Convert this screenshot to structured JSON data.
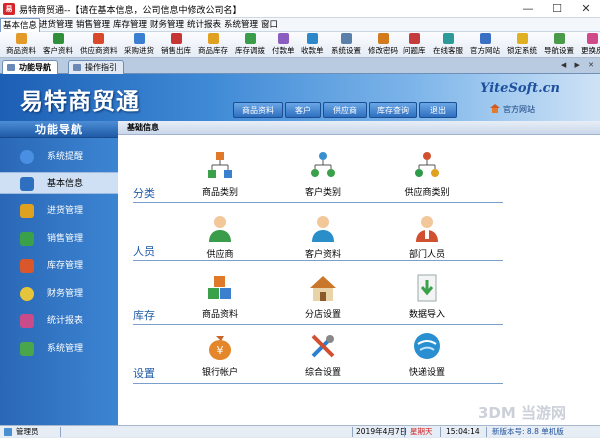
{
  "window": {
    "title": "易特商贸通--【请在基本信息，公司信息中修改公司名】",
    "minimize": "—",
    "maximize": "☐",
    "close": "✕"
  },
  "menu": [
    "基本信息",
    "进货管理",
    "销售管理",
    "库存管理",
    "财务管理",
    "统计报表",
    "系统管理",
    "窗口"
  ],
  "toolbar": [
    {
      "label": "商品资料",
      "icon": "box-icon",
      "color": "#e39a2a"
    },
    {
      "label": "客户资料",
      "icon": "customer-icon",
      "color": "#2f8f3a"
    },
    {
      "label": "供应商资料",
      "icon": "supplier-icon",
      "color": "#d9482b"
    },
    {
      "label": "采购进货",
      "icon": "purchase-icon",
      "color": "#3a7fd0"
    },
    {
      "label": "销售出库",
      "icon": "sales-icon",
      "color": "#c73434"
    },
    {
      "label": "商品库存",
      "icon": "inventory-icon",
      "color": "#e0a020"
    },
    {
      "label": "库存调拨",
      "icon": "transfer-icon",
      "color": "#3a9d4a"
    },
    {
      "label": "付款单",
      "icon": "payment-icon",
      "color": "#8b5dc0"
    },
    {
      "label": "收款单",
      "icon": "receipt-icon",
      "color": "#2c88c9"
    },
    {
      "label": "系统设置",
      "icon": "settings-icon",
      "color": "#5a7fa8"
    },
    {
      "label": "修改密码",
      "icon": "password-icon",
      "color": "#d27a1c"
    },
    {
      "label": "问题库",
      "icon": "question-icon",
      "color": "#c63b3b"
    },
    {
      "label": "在线客服",
      "icon": "chat-icon",
      "color": "#2c9a9a"
    },
    {
      "label": "官方网站",
      "icon": "globe-icon",
      "color": "#3a6fc4"
    },
    {
      "label": "锁定系统",
      "icon": "lock-icon",
      "color": "#e0b020"
    },
    {
      "label": "导航设置",
      "icon": "nav-icon",
      "color": "#4a9a4a"
    },
    {
      "label": "更换皮",
      "icon": "skin-icon",
      "color": "#d04a8a"
    }
  ],
  "tabs": [
    {
      "label": "功能导航",
      "active": true
    },
    {
      "label": "操作指引",
      "active": false
    }
  ],
  "tab_controls": "◀ ▶ ✕",
  "header": {
    "logo": "易特商贸通",
    "site": "YiteSoft.cn",
    "buttons": [
      "商品资料",
      "客户",
      "供应商",
      "库存查询",
      "退出"
    ],
    "official": "官方网站"
  },
  "sidebar": {
    "title": "功能导航",
    "items": [
      {
        "label": "系统提醒",
        "icon": "alarm-icon",
        "color": "#4a90e2",
        "active": false
      },
      {
        "label": "基本信息",
        "icon": "basic-info-icon",
        "color": "#2f6fbf",
        "active": true
      },
      {
        "label": "进货管理",
        "icon": "purchase-mgmt-icon",
        "color": "#e0a020",
        "active": false
      },
      {
        "label": "销售管理",
        "icon": "sales-mgmt-icon",
        "color": "#3aa14a",
        "active": false
      },
      {
        "label": "库存管理",
        "icon": "inventory-mgmt-icon",
        "color": "#d9572b",
        "active": false
      },
      {
        "label": "财务管理",
        "icon": "finance-mgmt-icon",
        "color": "#e7c53a",
        "active": false
      },
      {
        "label": "统计报表",
        "icon": "report-icon",
        "color": "#c94b8a",
        "active": false
      },
      {
        "label": "系统管理",
        "icon": "system-mgmt-icon",
        "color": "#4aa64a",
        "active": false
      }
    ]
  },
  "content": {
    "title": "基础信息",
    "sections": [
      {
        "label": "分类",
        "items": [
          {
            "label": "商品类别",
            "icon": "category-tree-icon",
            "color": "#e07a2a"
          },
          {
            "label": "客户类别",
            "icon": "customer-tree-icon",
            "color": "#3a8fd0"
          },
          {
            "label": "供应商类别",
            "icon": "supplier-tree-icon",
            "color": "#2f9a4a"
          }
        ]
      },
      {
        "label": "人员",
        "items": [
          {
            "label": "供应商",
            "icon": "supplier-person-icon",
            "color": "#3a9d4a"
          },
          {
            "label": "客户资料",
            "icon": "customer-person-icon",
            "color": "#2a8fc8"
          },
          {
            "label": "部门人员",
            "icon": "staff-person-icon",
            "color": "#d05030"
          }
        ]
      },
      {
        "label": "库存",
        "items": [
          {
            "label": "商品资料",
            "icon": "cubes-icon",
            "color": "#3a80cf"
          },
          {
            "label": "分店设置",
            "icon": "branch-house-icon",
            "color": "#c9772b"
          },
          {
            "label": "数据导入",
            "icon": "import-icon",
            "color": "#3aa14a"
          }
        ]
      },
      {
        "label": "设置",
        "items": [
          {
            "label": "银行帐户",
            "icon": "money-bag-icon",
            "color": "#e3872a"
          },
          {
            "label": "综合设置",
            "icon": "tools-icon",
            "color": "#2d7fd0"
          },
          {
            "label": "快递设置",
            "icon": "express-icon",
            "color": "#2a8fd0"
          }
        ]
      }
    ]
  },
  "status": {
    "user": "管理员",
    "date": "2019年4月7日",
    "weekday": "星期天",
    "time": "15:04:14",
    "version": "新版本号: 8.8 单机版"
  },
  "watermark": "3DM 当游网"
}
